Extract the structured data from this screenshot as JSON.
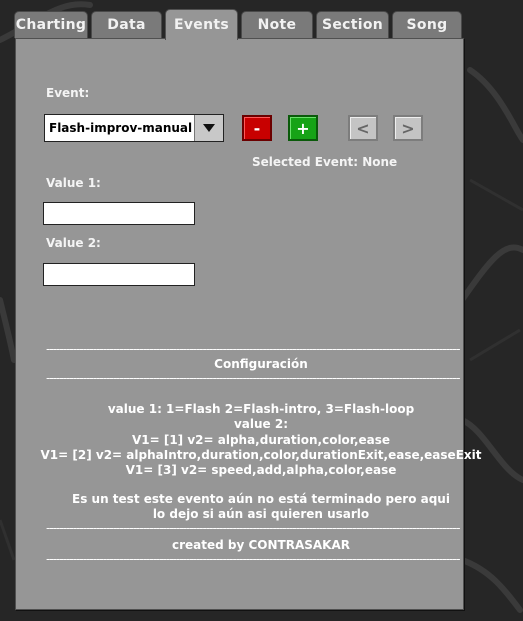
{
  "tabs": [
    {
      "label": "Charting",
      "active": false
    },
    {
      "label": "Data",
      "active": false
    },
    {
      "label": "Events",
      "active": true
    },
    {
      "label": "Note",
      "active": false
    },
    {
      "label": "Section",
      "active": false
    },
    {
      "label": "Song",
      "active": false
    }
  ],
  "event": {
    "label": "Event:",
    "selected_value": "Flash-improv-manual",
    "selected_event_text": "Selected Event: None",
    "remove_symbol": "-",
    "add_symbol": "+",
    "prev_symbol": "<",
    "next_symbol": ">"
  },
  "value1": {
    "label": "Value 1:",
    "value": ""
  },
  "value2": {
    "label": "Value 2:",
    "value": ""
  },
  "info": {
    "divider": "-----------------------------------------------------------------------------------------------------------------------------",
    "heading": "Configuración",
    "lines": [
      "value 1: 1=Flash 2=Flash-intro, 3=Flash-loop",
      "value 2:",
      "V1= [1] v2= alpha,duration,color,ease",
      "V1= [2] v2= alphaIntro,duration,color,durationExit,ease,easeExit",
      "V1= [3] v2= speed,add,alpha,color,ease"
    ],
    "note_lines": [
      "Es un test este evento aún no está terminado pero aqui",
      "lo dejo si aún asi quieren usarlo"
    ],
    "credit": "created by CONTRASAKAR"
  },
  "colors": {
    "panel": "#969696",
    "tab_inactive": "#7a7a7a",
    "remove_button": "#c80000",
    "add_button": "#16a316",
    "background": "#262626"
  }
}
